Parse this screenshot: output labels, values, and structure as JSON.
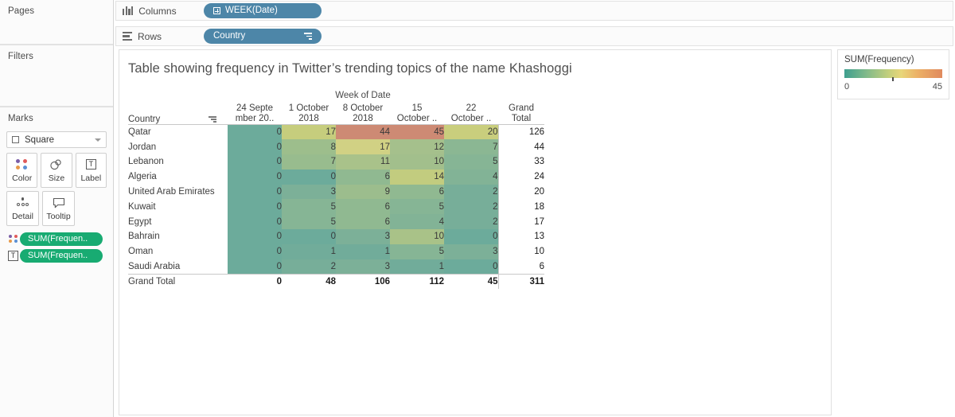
{
  "left_panel": {
    "pages": {
      "title": "Pages"
    },
    "filters": {
      "title": "Filters"
    },
    "marks": {
      "title": "Marks",
      "mark_type": "Square",
      "buttons": [
        {
          "label": "Color",
          "icon": "color-dots-icon"
        },
        {
          "label": "Size",
          "icon": "size-circles-icon"
        },
        {
          "label": "Label",
          "icon": "label-t-icon"
        },
        {
          "label": "Detail",
          "icon": "detail-dots-icon"
        },
        {
          "label": "Tooltip",
          "icon": "tooltip-bubble-icon"
        }
      ],
      "pills": [
        {
          "label": "SUM(Frequen..",
          "icon": "color-dots-icon"
        },
        {
          "label": "SUM(Frequen..",
          "icon": "label-t-icon"
        }
      ]
    }
  },
  "shelves": {
    "columns": {
      "label": "Columns",
      "icon": "columns-icon",
      "pill": "WEEK(Date)",
      "pill_icon": "expand-plus-icon"
    },
    "rows": {
      "label": "Rows",
      "icon": "rows-icon",
      "pill": "Country",
      "pill_icon": "sort-descending-icon"
    }
  },
  "viz": {
    "title": "Table showing frequency in Twitter’s trending topics of the name Khashoggi",
    "column_group_caption": "Week of Date",
    "row_header": "Country",
    "row_header_sort_icon": "sort-descending-icon"
  },
  "legend": {
    "title": "SUM(Frequency)",
    "min": "0",
    "max": "45",
    "gradient_colors": [
      "#3f9f8f",
      "#7fb98a",
      "#c3cf7c",
      "#e8d67a",
      "#ecb066",
      "#e08a5e"
    ]
  },
  "chart_data": {
    "type": "heatmap",
    "title": "Table showing frequency in Twitter’s trending topics of the name Khashoggi",
    "xlabel": "Week of Date",
    "ylabel": "Country",
    "legend_title": "SUM(Frequency)",
    "color_scale": {
      "min": 0,
      "max": 45,
      "type": "diverging-temperature"
    },
    "categories": [
      "24 Septe\nmber 20..",
      "1 October\n2018",
      "8 October\n2018",
      "15\nOctober ..",
      "22\nOctober ..",
      "Grand\nTotal"
    ],
    "column_headers": [
      {
        "line1": "24 Septe",
        "line2": "mber 20.."
      },
      {
        "line1": "1 October",
        "line2": "2018"
      },
      {
        "line1": "8 October",
        "line2": "2018"
      },
      {
        "line1": "15",
        "line2": "October .."
      },
      {
        "line1": "22",
        "line2": "October .."
      },
      {
        "line1": "Grand",
        "line2": "Total"
      }
    ],
    "rows": [
      {
        "country": "Qatar",
        "values": [
          0,
          17,
          44,
          45,
          20
        ],
        "total": 126,
        "colors": [
          "#6cab9b",
          "#c6cd7d",
          "#cd8a74",
          "#cd8a74",
          "#c9ce7d"
        ]
      },
      {
        "country": "Jordan",
        "values": [
          0,
          8,
          17,
          12,
          7
        ],
        "total": 44,
        "colors": [
          "#6cab9b",
          "#9dbe8c",
          "#d1d184",
          "#a5c08c",
          "#8bb793"
        ]
      },
      {
        "country": "Lebanon",
        "values": [
          0,
          7,
          11,
          10,
          5
        ],
        "total": 33,
        "colors": [
          "#6cab9b",
          "#98bc8e",
          "#a9c28a",
          "#a2bf8c",
          "#86b595"
        ]
      },
      {
        "country": "Algeria",
        "values": [
          0,
          0,
          6,
          14,
          4
        ],
        "total": 24,
        "colors": [
          "#6cab9b",
          "#6cab9b",
          "#90b991",
          "#c2cc7f",
          "#82b396"
        ]
      },
      {
        "country": "United Arab Emirates",
        "values": [
          0,
          3,
          9,
          6,
          2
        ],
        "total": 20,
        "colors": [
          "#6cab9b",
          "#7cb098",
          "#9cbd8d",
          "#90b991",
          "#77ae99"
        ]
      },
      {
        "country": "Kuwait",
        "values": [
          0,
          5,
          6,
          5,
          2
        ],
        "total": 18,
        "colors": [
          "#6cab9b",
          "#86b595",
          "#90b991",
          "#86b595",
          "#77ae99"
        ]
      },
      {
        "country": "Egypt",
        "values": [
          0,
          5,
          6,
          4,
          2
        ],
        "total": 17,
        "colors": [
          "#6cab9b",
          "#86b595",
          "#90b991",
          "#82b396",
          "#77ae99"
        ]
      },
      {
        "country": "Bahrain",
        "values": [
          0,
          0,
          3,
          10,
          0
        ],
        "total": 13,
        "colors": [
          "#6cab9b",
          "#6cab9b",
          "#7cb098",
          "#a9c288",
          "#6cab9b"
        ]
      },
      {
        "country": "Oman",
        "values": [
          0,
          1,
          1,
          5,
          3
        ],
        "total": 10,
        "colors": [
          "#6cab9b",
          "#71ac9a",
          "#71ac9a",
          "#86b595",
          "#7cb098"
        ]
      },
      {
        "country": "Saudi Arabia",
        "values": [
          0,
          2,
          3,
          1,
          0
        ],
        "total": 6,
        "colors": [
          "#6cab9b",
          "#77ae99",
          "#7cb098",
          "#71ac9a",
          "#6cab9b"
        ]
      }
    ],
    "grand_total_row": {
      "country": "Grand Total",
      "values": [
        0,
        48,
        106,
        112,
        45
      ],
      "total": 311
    }
  }
}
